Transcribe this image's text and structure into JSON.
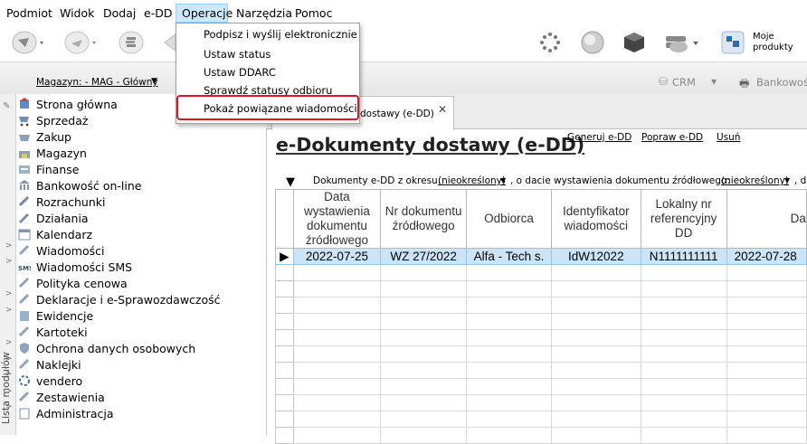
{
  "menubar": {
    "items": [
      "Podmiot",
      "Widok",
      "Dodaj",
      "e-DD",
      "Operacje",
      "Narzędzia",
      "Pomoc"
    ]
  },
  "operacje_menu": {
    "items": [
      "Podpisz i wyślij elektronicznie",
      "Ustaw status",
      "Ustaw DDARC",
      "Sprawdź statusy odbioru",
      "Pokaż powiązane wiadomości"
    ],
    "highlighted_index": 4,
    "highlight_color": "#e0141e"
  },
  "toolbar": {
    "moje_produkty": "Moje produkty",
    "crm_label": "CRM",
    "bankowosc_label": "Bankowoś",
    "icons": [
      "arrow-icon",
      "arrow-icon",
      "coins-icon",
      "tag-icon",
      "spinner-icon",
      "globe-icon",
      "cube-icon",
      "cloud-icon",
      "products-icon"
    ]
  },
  "magazyn": {
    "label": "Magazyn: - MAG - Główny"
  },
  "sidebar": {
    "vertical_label": "Lista modułów",
    "items": [
      "Strona główna",
      "Sprzedaż",
      "Zakup",
      "Magazyn",
      "Finanse",
      "Bankowość on-line",
      "Rozrachunki",
      "Działania",
      "Kalendarz",
      "Wiadomości",
      "Wiadomości SMS",
      "Polityka cenowa",
      "Deklaracje i e-Sprawozdawczość",
      "Ewidencje",
      "Kartoteki",
      "Ochrona danych osobowych",
      "Naklejki",
      "vendero",
      "Zestawienia",
      "Administracja"
    ]
  },
  "tab": {
    "label": "dostawy (e-DD)"
  },
  "page": {
    "title": "e-Dokumenty dostawy (e-DD)",
    "links": [
      "Generuj e-DD",
      "Popraw e-DD",
      "Usuń"
    ]
  },
  "filter": {
    "prefix": "Dokumenty e-DD z okresu:",
    "value1": "(nieokreślony)",
    "middle": ", o dacie wystawienia dokumentu źródłowego:",
    "value2": "(nieokreślony)",
    "suffix": ", d"
  },
  "grid": {
    "columns": [
      "Data wystawienia dokumentu źródłowego",
      "Nr dokumentu źródłowego",
      "Odbiorca",
      "Identyfikator wiadomości",
      "Lokalny nr referencyjny DD",
      "Da"
    ],
    "rows": [
      [
        "2022-07-25",
        "WZ 27/2022",
        "Alfa - Tech s.",
        "IdW12022",
        "N1111111111",
        "2022-07-28"
      ]
    ],
    "selected_color": "#cde4f7"
  }
}
